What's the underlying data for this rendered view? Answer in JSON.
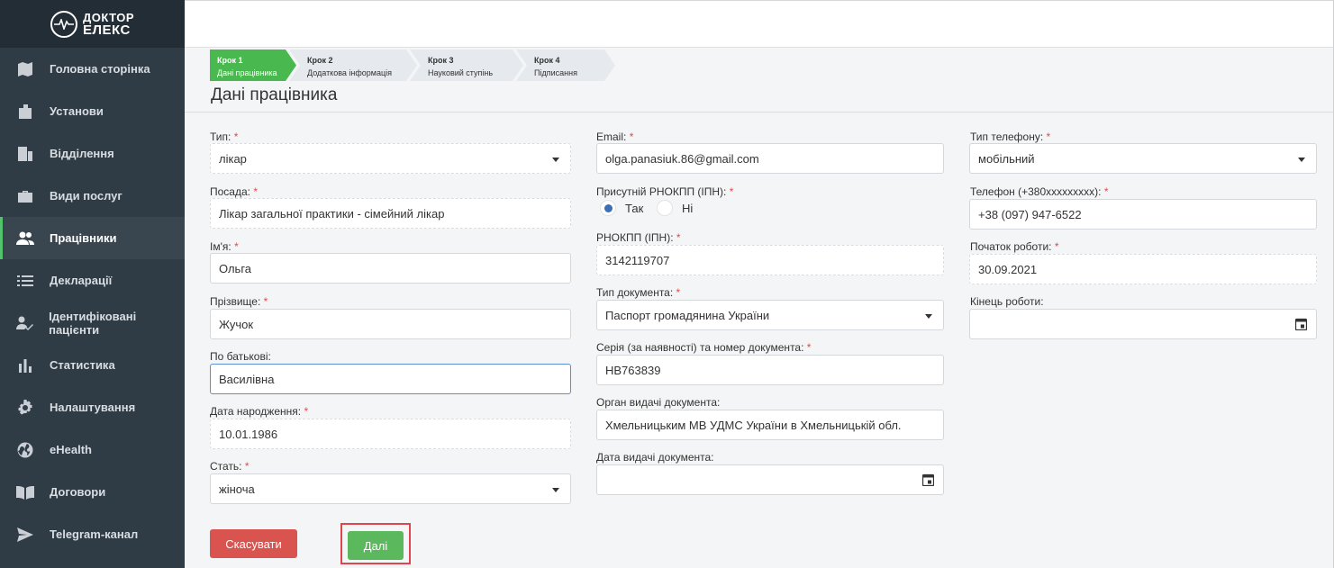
{
  "brand": {
    "line1": "ДОКТОР",
    "line2": "ЕЛЕКС"
  },
  "sidebar": {
    "items": [
      {
        "label": "Головна сторінка",
        "icon": "map-icon"
      },
      {
        "label": "Установи",
        "icon": "building-icon"
      },
      {
        "label": "Відділення",
        "icon": "office-icon"
      },
      {
        "label": "Види послуг",
        "icon": "briefcase-icon"
      },
      {
        "label": "Працівники",
        "icon": "people-icon",
        "active": true
      },
      {
        "label": "Декларації",
        "icon": "list-icon"
      },
      {
        "label": "Ідентифіковані пацієнти",
        "icon": "user-check-icon"
      },
      {
        "label": "Статистика",
        "icon": "bar-chart-icon"
      },
      {
        "label": "Налаштування",
        "icon": "gear-icon"
      },
      {
        "label": "eHealth",
        "icon": "globe-icon"
      },
      {
        "label": "Договори",
        "icon": "book-icon"
      },
      {
        "label": "Telegram-канал",
        "icon": "send-icon"
      }
    ]
  },
  "steps": [
    {
      "num": "Крок 1",
      "label": "Дані працівника"
    },
    {
      "num": "Крок 2",
      "label": "Додаткова інформація"
    },
    {
      "num": "Крок 3",
      "label": "Науковий ступінь"
    },
    {
      "num": "Крок 4",
      "label": "Підписання"
    }
  ],
  "page_title": "Дані працівника",
  "required_mark": "*",
  "form": {
    "type": {
      "label": "Тип:",
      "value": "лікар"
    },
    "position": {
      "label": "Посада:",
      "value": "Лікар загальної практики - сімейний лікар"
    },
    "first_name": {
      "label": "Ім'я:",
      "value": "Ольга"
    },
    "last_name": {
      "label": "Прізвище:",
      "value": "Жучок"
    },
    "patronymic": {
      "label": "По батькові:",
      "value": "Василівна"
    },
    "birth_date": {
      "label": "Дата народження:",
      "value": "10.01.1986"
    },
    "sex": {
      "label": "Стать:",
      "value": "жіноча"
    },
    "email": {
      "label": "Email:",
      "value": "olga.panasiuk.86@gmail.com"
    },
    "rnokpp_present": {
      "label": "Присутній РНОКПП (ІПН):",
      "yes": "Так",
      "no": "Ні"
    },
    "rnokpp": {
      "label": "РНОКПП (ІПН):",
      "value": "3142119707"
    },
    "doc_type": {
      "label": "Тип документа:",
      "value": "Паспорт громадянина України"
    },
    "doc_number": {
      "label": "Серія (за наявності) та номер документа:",
      "value": "НВ763839"
    },
    "doc_issuer": {
      "label": "Орган видачі документа:",
      "value": "Хмельницьким МВ УДМС України в Хмельницькій обл."
    },
    "doc_issue_date": {
      "label": "Дата видачі документа:",
      "value": ""
    },
    "phone_type": {
      "label": "Тип телефону:",
      "value": "мобільний"
    },
    "phone": {
      "label": "Телефон (+380xxxxxxxxx):",
      "value": "+38 (097) 947-6522"
    },
    "start_date": {
      "label": "Початок роботи:",
      "value": "30.09.2021"
    },
    "end_date": {
      "label": "Кінець роботи:",
      "value": ""
    }
  },
  "buttons": {
    "cancel": "Скасувати",
    "next": "Далі"
  },
  "colors": {
    "sidebar": "#2f3b45",
    "accent_green": "#49b94f",
    "danger": "#d9534f",
    "highlight": "#e0454b"
  }
}
